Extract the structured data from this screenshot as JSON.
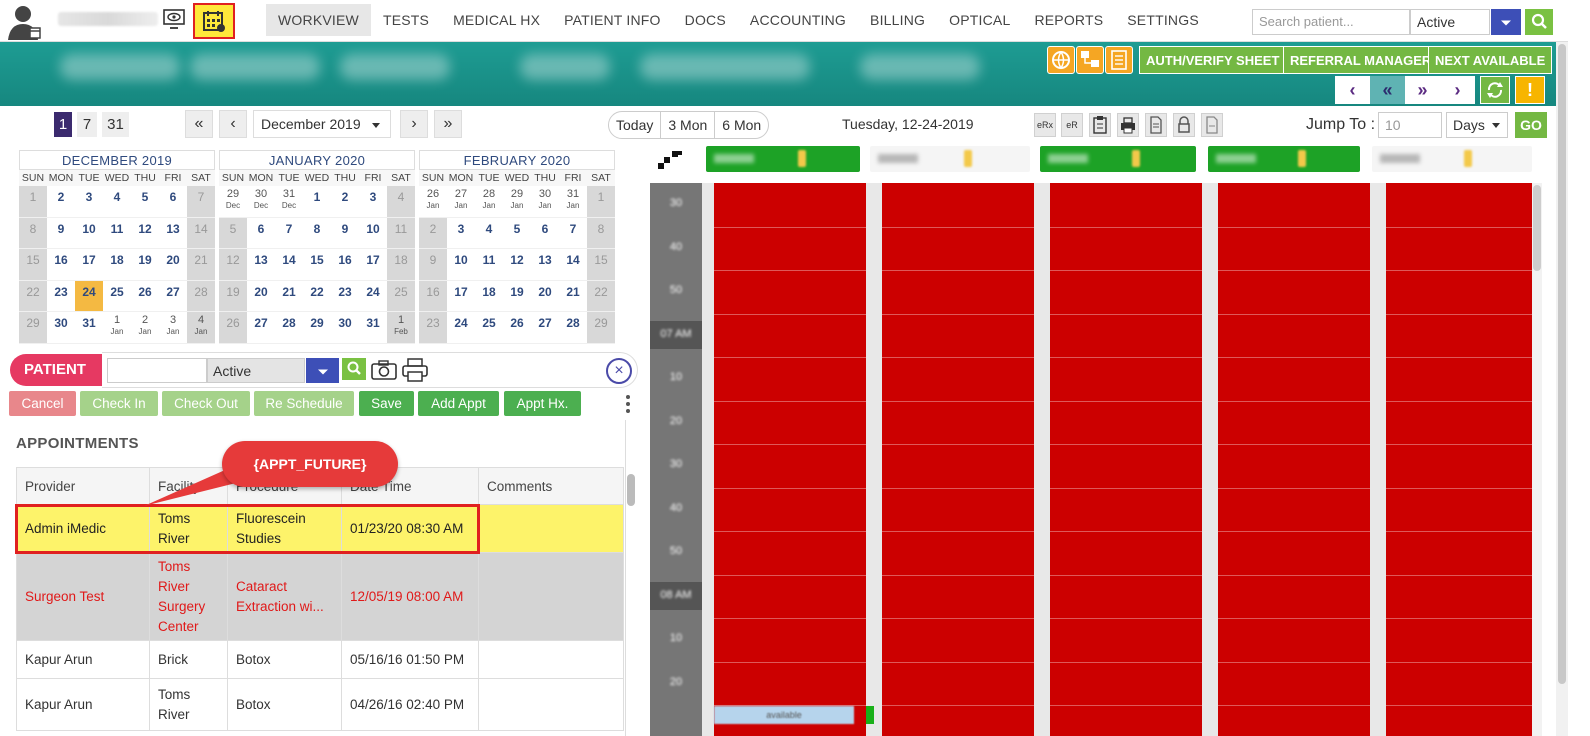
{
  "colors": {
    "brand_teal": "#1e9c93",
    "accent_green": "#74b843",
    "accent_blue": "#3d4fb7",
    "patient_pink": "#e63962",
    "future_highlight": "#fdf36a",
    "past_text": "#e01919",
    "slot_red": "#cc0000"
  },
  "header": {
    "nav": [
      "WORKVIEW",
      "TESTS",
      "MEDICAL HX",
      "PATIENT INFO",
      "DOCS",
      "ACCOUNTING",
      "BILLING",
      "OPTICAL",
      "REPORTS",
      "SETTINGS"
    ],
    "active_nav": "WORKVIEW",
    "search_placeholder": "Search patient...",
    "status_value": "Active",
    "icons": [
      "user-avatar-icon",
      "monitor-eye-icon",
      "scheduler-calendar-icon",
      "search-icon"
    ]
  },
  "band": {
    "buttons": [
      "AUTH/VERIFY SHEET",
      "REFERRAL MANAGER",
      "NEXT AVAILABLE"
    ],
    "icons": [
      "globe-sync-icon",
      "users-icon",
      "grid-report-icon",
      "refresh-icon",
      "warning-icon"
    ],
    "warning_label": "!"
  },
  "toolbar": {
    "view_counts": [
      "1",
      "7",
      "31"
    ],
    "selected_view": "1",
    "month_value": "December 2019",
    "range_buttons": [
      "Today",
      "3 Mon",
      "6 Mon"
    ],
    "current_date": "Tuesday, 12-24-2019",
    "tool_labels": [
      "eRx",
      "eR"
    ],
    "jump_label": "Jump To :",
    "jump_placeholder": "10",
    "jump_unit": "Days",
    "go_label": "GO"
  },
  "calendars": [
    {
      "title": "DECEMBER 2019",
      "weeks": [
        [
          [
            "1",
            "w"
          ],
          [
            "2",
            ""
          ],
          [
            "3",
            ""
          ],
          [
            "4",
            ""
          ],
          [
            "5",
            ""
          ],
          [
            "6",
            ""
          ],
          [
            "7",
            "w"
          ]
        ],
        [
          [
            "8",
            "w"
          ],
          [
            "9",
            ""
          ],
          [
            "10",
            ""
          ],
          [
            "11",
            ""
          ],
          [
            "12",
            ""
          ],
          [
            "13",
            ""
          ],
          [
            "14",
            "w"
          ]
        ],
        [
          [
            "15",
            "w"
          ],
          [
            "16",
            ""
          ],
          [
            "17",
            ""
          ],
          [
            "18",
            ""
          ],
          [
            "19",
            ""
          ],
          [
            "20",
            ""
          ],
          [
            "21",
            "w"
          ]
        ],
        [
          [
            "22",
            "w"
          ],
          [
            "23",
            ""
          ],
          [
            "24",
            "t"
          ],
          [
            "25",
            ""
          ],
          [
            "26",
            ""
          ],
          [
            "27",
            ""
          ],
          [
            "28",
            "w"
          ]
        ],
        [
          [
            "29",
            "w"
          ],
          [
            "30",
            ""
          ],
          [
            "31",
            ""
          ],
          [
            "1|Jan",
            "o"
          ],
          [
            "2|Jan",
            "o"
          ],
          [
            "3|Jan",
            "o"
          ],
          [
            "4|Jan",
            "wo"
          ]
        ]
      ]
    },
    {
      "title": "JANUARY 2020",
      "weeks": [
        [
          [
            "29|Dec",
            "o"
          ],
          [
            "30|Dec",
            "o"
          ],
          [
            "31|Dec",
            "o"
          ],
          [
            "1",
            ""
          ],
          [
            "2",
            ""
          ],
          [
            "3",
            ""
          ],
          [
            "4",
            "w"
          ]
        ],
        [
          [
            "5",
            "w"
          ],
          [
            "6",
            ""
          ],
          [
            "7",
            ""
          ],
          [
            "8",
            ""
          ],
          [
            "9",
            ""
          ],
          [
            "10",
            ""
          ],
          [
            "11",
            "w"
          ]
        ],
        [
          [
            "12",
            "w"
          ],
          [
            "13",
            ""
          ],
          [
            "14",
            ""
          ],
          [
            "15",
            ""
          ],
          [
            "16",
            ""
          ],
          [
            "17",
            ""
          ],
          [
            "18",
            "w"
          ]
        ],
        [
          [
            "19",
            "w"
          ],
          [
            "20",
            ""
          ],
          [
            "21",
            ""
          ],
          [
            "22",
            ""
          ],
          [
            "23",
            ""
          ],
          [
            "24",
            ""
          ],
          [
            "25",
            "w"
          ]
        ],
        [
          [
            "26",
            "w"
          ],
          [
            "27",
            ""
          ],
          [
            "28",
            ""
          ],
          [
            "29",
            ""
          ],
          [
            "30",
            ""
          ],
          [
            "31",
            ""
          ],
          [
            "1|Feb",
            "wo"
          ]
        ]
      ]
    },
    {
      "title": "FEBRUARY 2020",
      "weeks": [
        [
          [
            "26|Jan",
            "o"
          ],
          [
            "27|Jan",
            "o"
          ],
          [
            "28|Jan",
            "o"
          ],
          [
            "29|Jan",
            "o"
          ],
          [
            "30|Jan",
            "o"
          ],
          [
            "31|Jan",
            "o"
          ],
          [
            "1",
            "w"
          ]
        ],
        [
          [
            "2",
            "w"
          ],
          [
            "3",
            ""
          ],
          [
            "4",
            ""
          ],
          [
            "5",
            ""
          ],
          [
            "6",
            ""
          ],
          [
            "7",
            ""
          ],
          [
            "8",
            "w"
          ]
        ],
        [
          [
            "9",
            "w"
          ],
          [
            "10",
            ""
          ],
          [
            "11",
            ""
          ],
          [
            "12",
            ""
          ],
          [
            "13",
            ""
          ],
          [
            "14",
            ""
          ],
          [
            "15",
            "w"
          ]
        ],
        [
          [
            "16",
            "w"
          ],
          [
            "17",
            ""
          ],
          [
            "18",
            ""
          ],
          [
            "19",
            ""
          ],
          [
            "20",
            ""
          ],
          [
            "21",
            ""
          ],
          [
            "22",
            "w"
          ]
        ],
        [
          [
            "23",
            "w"
          ],
          [
            "24",
            ""
          ],
          [
            "25",
            ""
          ],
          [
            "26",
            ""
          ],
          [
            "27",
            ""
          ],
          [
            "28",
            ""
          ],
          [
            "29",
            "w"
          ]
        ]
      ]
    }
  ],
  "weekdays": [
    "SUN",
    "MON",
    "TUE",
    "WED",
    "THU",
    "FRI",
    "SAT"
  ],
  "patient": {
    "label": "PATIENT",
    "status_value": "Active",
    "close_label": "×",
    "icons": [
      "search-icon",
      "camera-icon",
      "printer-icon",
      "close-icon"
    ]
  },
  "actions": [
    "Cancel",
    "Check In",
    "Check Out",
    "Re Schedule",
    "Save",
    "Add Appt",
    "Appt Hx."
  ],
  "appointments": {
    "title": "APPOINTMENTS",
    "columns": [
      "Provider",
      "Facility",
      "Procedure",
      "Date Time",
      "Comments"
    ],
    "callout": "{APPT_FUTURE}",
    "rows": [
      {
        "kind": "future",
        "cells": [
          "Admin iMedic",
          "Toms River",
          "Fluorescein Studies",
          "01/23/20 08:30 AM",
          ""
        ]
      },
      {
        "kind": "past",
        "cells": [
          "Surgeon Test",
          "Toms River Surgery Center",
          "Cataract Extraction wi...",
          "12/05/19 08:00 AM",
          ""
        ]
      },
      {
        "kind": "plain",
        "cells": [
          "Kapur Arun",
          "Brick",
          "Botox",
          "05/16/16 01:50 PM",
          ""
        ]
      },
      {
        "kind": "plain2",
        "cells": [
          "Kapur Arun",
          "Toms River",
          "Botox",
          "04/26/16 02:40 PM",
          ""
        ]
      }
    ]
  },
  "scheduler": {
    "time_labels": [
      "30",
      "40",
      "50",
      "07 AM",
      "10",
      "20",
      "30",
      "40",
      "50",
      "08 AM",
      "10",
      "20"
    ],
    "available_label": "available"
  }
}
